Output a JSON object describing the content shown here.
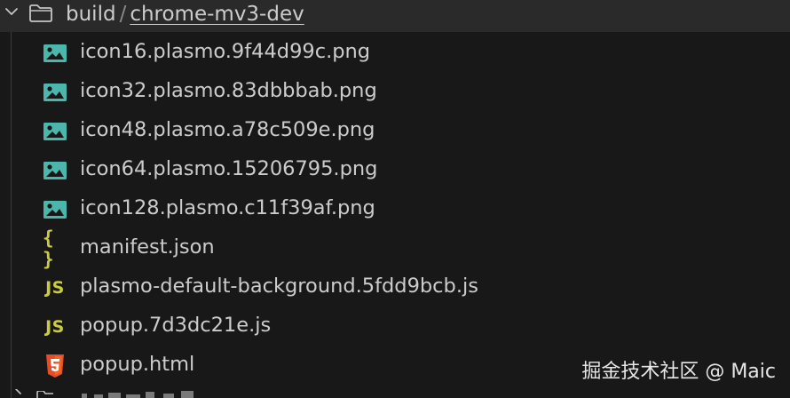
{
  "folder": {
    "parent": "build",
    "separator": "/",
    "current": "chrome-mv3-dev"
  },
  "files": [
    {
      "name": "icon16.plasmo.9f44d99c.png",
      "type": "image"
    },
    {
      "name": "icon32.plasmo.83dbbbab.png",
      "type": "image"
    },
    {
      "name": "icon48.plasmo.a78c509e.png",
      "type": "image"
    },
    {
      "name": "icon64.plasmo.15206795.png",
      "type": "image"
    },
    {
      "name": "icon128.plasmo.c11f39af.png",
      "type": "image"
    },
    {
      "name": "manifest.json",
      "type": "json",
      "icon_text": "{ }"
    },
    {
      "name": "plasmo-default-background.5fdd9bcb.js",
      "type": "js",
      "icon_text": "JS"
    },
    {
      "name": "popup.7d3dc21e.js",
      "type": "js",
      "icon_text": "JS"
    },
    {
      "name": "popup.html",
      "type": "html"
    }
  ],
  "watermark": "掘金技术社区 @ Maic",
  "colors": {
    "background": "#181818",
    "header_background": "#2a2a2a",
    "text": "#cccccc",
    "image_icon": "#4db6ac",
    "json_js_icon": "#cbcb41",
    "html_icon": "#e44d26",
    "folder_icon": "#c5c5c5"
  },
  "icons": {
    "header_chevron": "chevron-down-icon",
    "header_folder": "folder-icon",
    "image": "image-file-icon",
    "json": "json-file-icon",
    "js": "js-file-icon",
    "html": "html-file-icon"
  }
}
